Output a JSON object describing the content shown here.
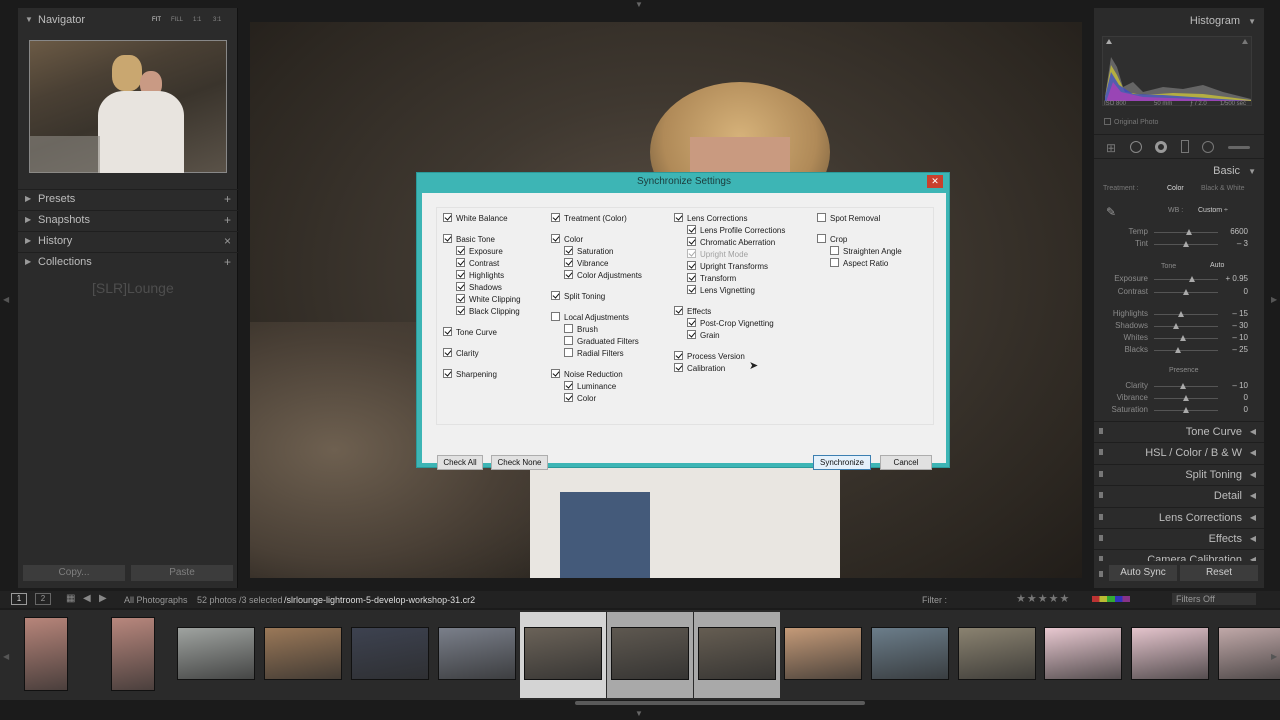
{
  "left_panel": {
    "navigator": {
      "title": "Navigator",
      "modes": [
        "FIT",
        "FILL",
        "1:1",
        "3:1"
      ]
    },
    "sections": [
      {
        "label": "Presets",
        "action": "+"
      },
      {
        "label": "Snapshots",
        "action": "+"
      },
      {
        "label": "History",
        "action": "×"
      },
      {
        "label": "Collections",
        "action": "+"
      }
    ],
    "watermark": "[SLR]Lounge",
    "copy_label": "Copy...",
    "paste_label": "Paste"
  },
  "right_panel": {
    "histogram_title": "Histogram",
    "histogram_info": {
      "iso": "ISO 800",
      "focal": "50 mm",
      "aperture": "ƒ / 2.0",
      "shutter": "1/500 sec"
    },
    "original_photo": "Original Photo",
    "basic_title": "Basic",
    "treatment_label": "Treatment :",
    "treatment_color": "Color",
    "treatment_bw": "Black & White",
    "wb_label": "WB :",
    "wb_value": "Custom ÷",
    "tone_label": "Tone",
    "tone_auto": "Auto",
    "presence_label": "Presence",
    "sliders": [
      {
        "name": "Temp",
        "value": "6600",
        "pos": 0.55
      },
      {
        "name": "Tint",
        "value": "– 3",
        "pos": 0.5
      },
      {
        "name": "Exposure",
        "value": "+ 0.95",
        "pos": 0.6
      },
      {
        "name": "Contrast",
        "value": "0",
        "pos": 0.5
      },
      {
        "name": "Highlights",
        "value": "– 15",
        "pos": 0.42
      },
      {
        "name": "Shadows",
        "value": "– 30",
        "pos": 0.35
      },
      {
        "name": "Whites",
        "value": "– 10",
        "pos": 0.45
      },
      {
        "name": "Blacks",
        "value": "– 25",
        "pos": 0.38
      },
      {
        "name": "Clarity",
        "value": "– 10",
        "pos": 0.45
      },
      {
        "name": "Vibrance",
        "value": "0",
        "pos": 0.5
      },
      {
        "name": "Saturation",
        "value": "0",
        "pos": 0.5
      }
    ],
    "sections": [
      "Tone Curve",
      "HSL  /  Color  /  B & W",
      "Split Toning",
      "Detail",
      "Lens Corrections",
      "Effects",
      "Camera Calibration"
    ],
    "autosync_label": "Auto Sync",
    "reset_label": "Reset"
  },
  "filmstrip": {
    "pages": [
      "1",
      "2"
    ],
    "source": "All Photographs",
    "info": "52 photos /3 selected",
    "filename": "/slrlounge-lightroom-5-develop-workshop-31.cr2",
    "filter_label": "Filter :",
    "filter_value": "Filters Off",
    "thumb_colors": [
      "#b7857a",
      "#b8877d",
      "#9fa3a0",
      "#9a7858",
      "#3d4250",
      "#7a7f8a",
      "#6a6258",
      "#5e5850",
      "#655d52",
      "#c49a78",
      "#6b7d8a",
      "#8a8270",
      "#e8c8d0",
      "#e4c4cc",
      "#c0a8a8"
    ]
  },
  "dialog": {
    "title": "Synchronize Settings",
    "close": "✕",
    "checkboxes": [
      {
        "label": "White Balance",
        "on": true,
        "col": 0,
        "row": 0,
        "indent": 0
      },
      {
        "label": "Basic Tone",
        "on": true,
        "col": 0,
        "row": 1.75,
        "indent": 0
      },
      {
        "label": "Exposure",
        "on": true,
        "col": 0,
        "row": 2.75,
        "indent": 1
      },
      {
        "label": "Contrast",
        "on": true,
        "col": 0,
        "row": 3.75,
        "indent": 1
      },
      {
        "label": "Highlights",
        "on": true,
        "col": 0,
        "row": 4.75,
        "indent": 1
      },
      {
        "label": "Shadows",
        "on": true,
        "col": 0,
        "row": 5.75,
        "indent": 1
      },
      {
        "label": "White Clipping",
        "on": true,
        "col": 0,
        "row": 6.75,
        "indent": 1
      },
      {
        "label": "Black Clipping",
        "on": true,
        "col": 0,
        "row": 7.75,
        "indent": 1
      },
      {
        "label": "Tone Curve",
        "on": true,
        "col": 0,
        "row": 9.5,
        "indent": 0
      },
      {
        "label": "Clarity",
        "on": true,
        "col": 0,
        "row": 11.25,
        "indent": 0
      },
      {
        "label": "Sharpening",
        "on": true,
        "col": 0,
        "row": 13,
        "indent": 0
      },
      {
        "label": "Treatment (Color)",
        "on": true,
        "col": 1,
        "row": 0,
        "indent": 0
      },
      {
        "label": "Color",
        "on": true,
        "col": 1,
        "row": 1.75,
        "indent": 0
      },
      {
        "label": "Saturation",
        "on": true,
        "col": 1,
        "row": 2.75,
        "indent": 1
      },
      {
        "label": "Vibrance",
        "on": true,
        "col": 1,
        "row": 3.75,
        "indent": 1
      },
      {
        "label": "Color Adjustments",
        "on": true,
        "col": 1,
        "row": 4.75,
        "indent": 1
      },
      {
        "label": "Split Toning",
        "on": true,
        "col": 1,
        "row": 6.5,
        "indent": 0
      },
      {
        "label": "Local Adjustments",
        "on": false,
        "col": 1,
        "row": 8.25,
        "indent": 0
      },
      {
        "label": "Brush",
        "on": false,
        "col": 1,
        "row": 9.25,
        "indent": 1
      },
      {
        "label": "Graduated Filters",
        "on": false,
        "col": 1,
        "row": 10.25,
        "indent": 1
      },
      {
        "label": "Radial Filters",
        "on": false,
        "col": 1,
        "row": 11.25,
        "indent": 1
      },
      {
        "label": "Noise Reduction",
        "on": true,
        "col": 1,
        "row": 13,
        "indent": 0
      },
      {
        "label": "Luminance",
        "on": true,
        "col": 1,
        "row": 14,
        "indent": 1
      },
      {
        "label": "Color",
        "on": true,
        "col": 1,
        "row": 15,
        "indent": 1
      },
      {
        "label": "Lens Corrections",
        "on": true,
        "col": 2,
        "row": 0,
        "indent": 0
      },
      {
        "label": "Lens Profile Corrections",
        "on": true,
        "col": 2,
        "row": 1,
        "indent": 1
      },
      {
        "label": "Chromatic Aberration",
        "on": true,
        "col": 2,
        "row": 2,
        "indent": 1
      },
      {
        "label": "Upright Mode",
        "on": true,
        "col": 2,
        "row": 3,
        "indent": 1,
        "disabled": true
      },
      {
        "label": "Upright Transforms",
        "on": true,
        "col": 2,
        "row": 4,
        "indent": 1
      },
      {
        "label": "Transform",
        "on": true,
        "col": 2,
        "row": 5,
        "indent": 1
      },
      {
        "label": "Lens Vignetting",
        "on": true,
        "col": 2,
        "row": 6,
        "indent": 1
      },
      {
        "label": "Effects",
        "on": true,
        "col": 2,
        "row": 7.75,
        "indent": 0
      },
      {
        "label": "Post-Crop Vignetting",
        "on": true,
        "col": 2,
        "row": 8.75,
        "indent": 1
      },
      {
        "label": "Grain",
        "on": true,
        "col": 2,
        "row": 9.75,
        "indent": 1
      },
      {
        "label": "Process Version",
        "on": true,
        "col": 2,
        "row": 11.5,
        "indent": 0
      },
      {
        "label": "Calibration",
        "on": true,
        "col": 2,
        "row": 12.5,
        "indent": 0
      },
      {
        "label": "Spot Removal",
        "on": false,
        "col": 3,
        "row": 0,
        "indent": 0
      },
      {
        "label": "Crop",
        "on": false,
        "col": 3,
        "row": 1.75,
        "indent": 0
      },
      {
        "label": "Straighten Angle",
        "on": false,
        "col": 3,
        "row": 2.75,
        "indent": 1
      },
      {
        "label": "Aspect Ratio",
        "on": false,
        "col": 3,
        "row": 3.75,
        "indent": 1
      }
    ],
    "check_all": "Check All",
    "check_none": "Check None",
    "synchronize": "Synchronize",
    "cancel": "Cancel"
  }
}
